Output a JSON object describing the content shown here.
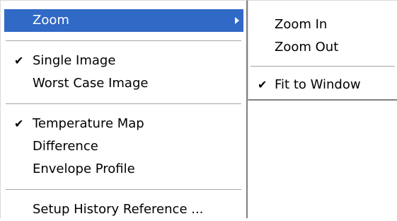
{
  "main_menu": {
    "zoom": {
      "label": "Zoom",
      "highlighted": true,
      "has_submenu": true,
      "arrow_icon": "submenu-arrow-icon"
    },
    "single_image": {
      "label": "Single Image",
      "checked": true
    },
    "worst_case_image": {
      "label": "Worst Case Image",
      "checked": false
    },
    "temperature_map": {
      "label": "Temperature Map",
      "checked": true
    },
    "difference": {
      "label": "Difference",
      "checked": false
    },
    "envelope_profile": {
      "label": "Envelope Profile",
      "checked": false
    },
    "setup_history_reference": {
      "label": "Setup History Reference ...",
      "checked": false
    }
  },
  "zoom_submenu": {
    "zoom_in": {
      "label": "Zoom In",
      "checked": false
    },
    "zoom_out": {
      "label": "Zoom Out",
      "checked": false
    },
    "fit_to_window": {
      "label": "Fit to Window",
      "checked": true
    }
  },
  "check_glyph": "✔",
  "colors": {
    "highlight": "#3169c6",
    "highlight_text": "#ffffff",
    "separator": "#a6a6a6",
    "border_shadow": "#808080"
  }
}
